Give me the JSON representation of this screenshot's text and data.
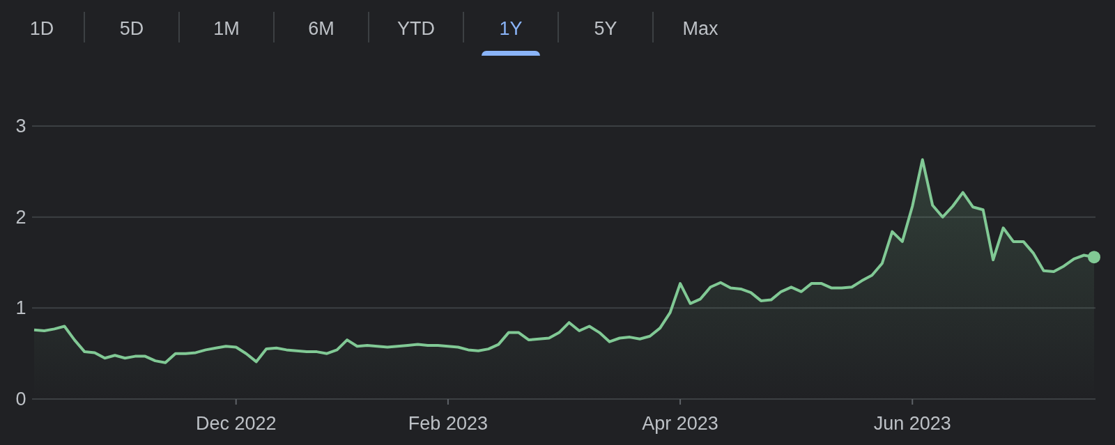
{
  "tabs": [
    {
      "label": "1D",
      "selected": false
    },
    {
      "label": "5D",
      "selected": false
    },
    {
      "label": "1M",
      "selected": false
    },
    {
      "label": "6M",
      "selected": false
    },
    {
      "label": "YTD",
      "selected": false
    },
    {
      "label": "1Y",
      "selected": true
    },
    {
      "label": "5Y",
      "selected": false
    },
    {
      "label": "Max",
      "selected": false
    }
  ],
  "chart": {
    "chart_data": {
      "type": "area",
      "grid": true,
      "ylim": [
        0,
        3
      ],
      "yticks": [
        0,
        1,
        2,
        3
      ],
      "categories": [
        null,
        null,
        null,
        null,
        null,
        null,
        null,
        null,
        null,
        null,
        null,
        null,
        null,
        null,
        null,
        null,
        null,
        null,
        null,
        null,
        "Dec 2022",
        null,
        null,
        null,
        null,
        null,
        null,
        null,
        null,
        null,
        null,
        null,
        null,
        null,
        null,
        null,
        null,
        null,
        null,
        null,
        null,
        "Feb 2023",
        null,
        null,
        null,
        null,
        null,
        null,
        null,
        null,
        null,
        null,
        null,
        null,
        null,
        null,
        null,
        null,
        null,
        null,
        null,
        null,
        null,
        null,
        "Apr 2023",
        null,
        null,
        null,
        null,
        null,
        null,
        null,
        null,
        null,
        null,
        null,
        null,
        null,
        null,
        null,
        null,
        null,
        null,
        null,
        null,
        null,
        null,
        "Jun 2023",
        null,
        null,
        null,
        null,
        null,
        null,
        null,
        null,
        null,
        null,
        null,
        null,
        null,
        null,
        null,
        null,
        null,
        null
      ],
      "series": [
        {
          "color": "#81c995",
          "values": [
            0.76,
            0.75,
            0.77,
            0.8,
            0.65,
            0.52,
            0.51,
            0.45,
            0.48,
            0.45,
            0.47,
            0.47,
            0.42,
            0.4,
            0.5,
            0.5,
            0.51,
            0.54,
            0.56,
            0.58,
            0.57,
            0.5,
            0.41,
            0.55,
            0.56,
            0.54,
            0.53,
            0.52,
            0.52,
            0.5,
            0.54,
            0.65,
            0.58,
            0.59,
            0.58,
            0.57,
            0.58,
            0.59,
            0.6,
            0.59,
            0.59,
            0.58,
            0.57,
            0.54,
            0.53,
            0.55,
            0.6,
            0.73,
            0.73,
            0.65,
            0.66,
            0.67,
            0.73,
            0.84,
            0.75,
            0.8,
            0.73,
            0.63,
            0.67,
            0.68,
            0.66,
            0.69,
            0.78,
            0.95,
            1.27,
            1.05,
            1.1,
            1.23,
            1.28,
            1.22,
            1.21,
            1.17,
            1.08,
            1.09,
            1.18,
            1.23,
            1.18,
            1.27,
            1.27,
            1.22,
            1.22,
            1.23,
            1.3,
            1.36,
            1.49,
            1.84,
            1.73,
            2.12,
            2.63,
            2.13,
            2.0,
            2.12,
            2.27,
            2.11,
            2.08,
            1.53,
            1.88,
            1.73,
            1.73,
            1.6,
            1.41,
            1.4,
            1.46,
            1.54,
            1.58,
            1.56
          ]
        }
      ]
    }
  }
}
